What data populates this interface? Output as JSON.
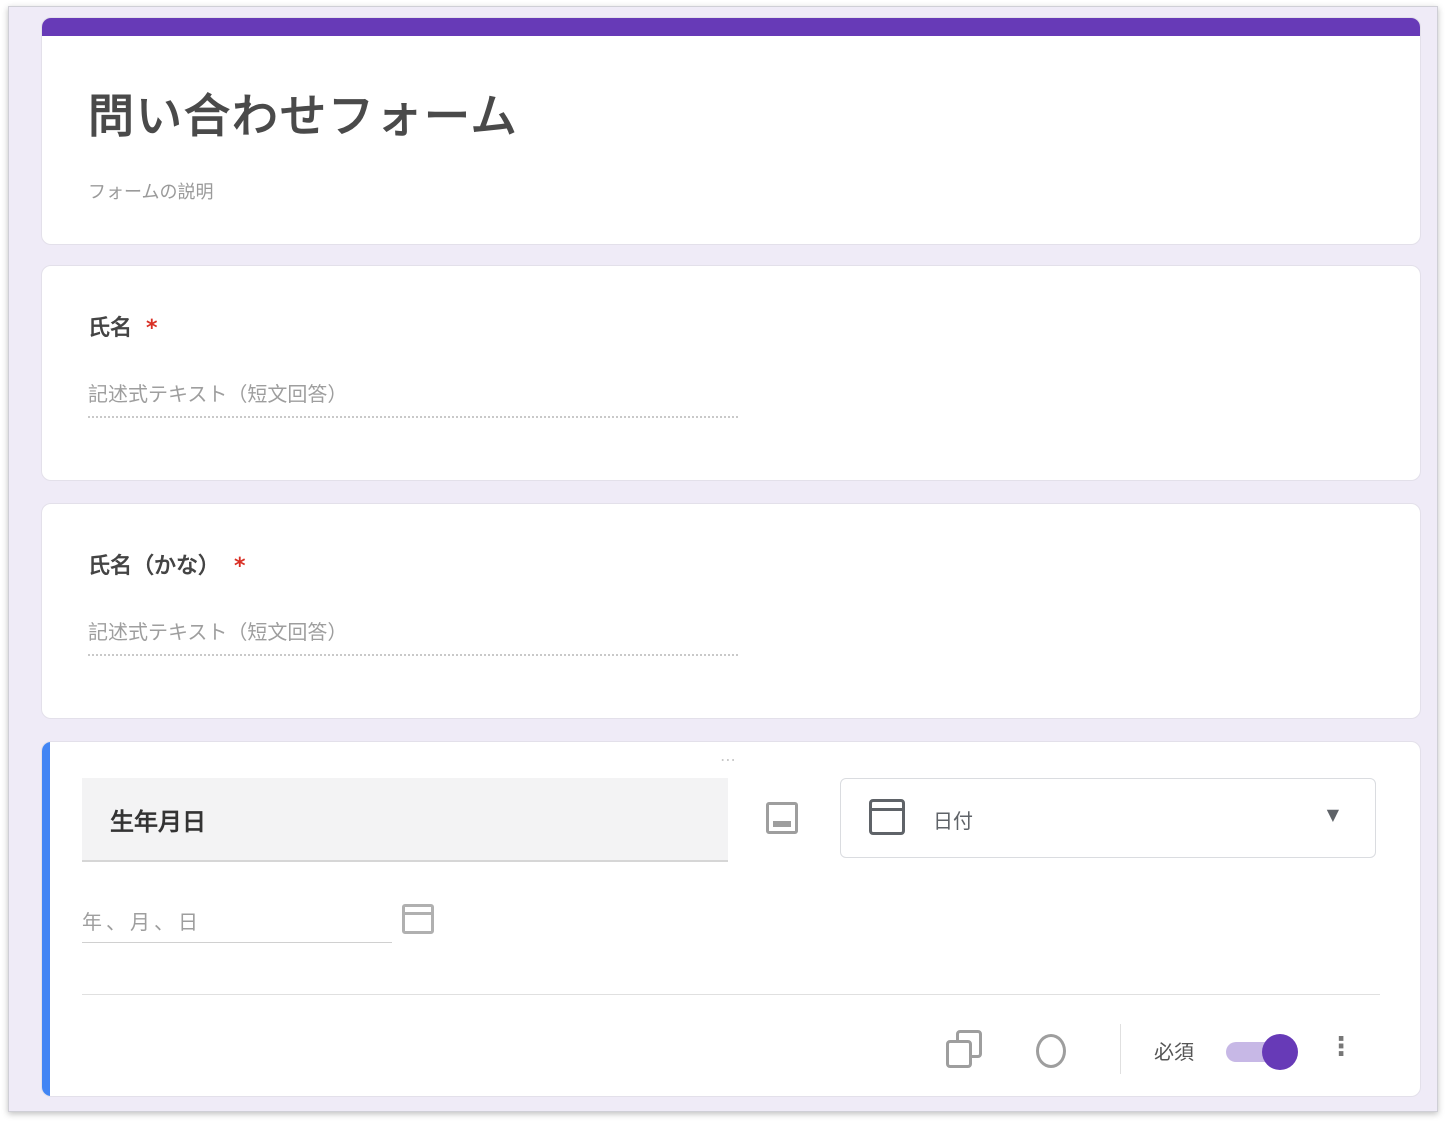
{
  "form": {
    "title": "問い合わせフォーム",
    "description": "フォームの説明"
  },
  "questions": [
    {
      "title": "氏名",
      "required_mark": "*",
      "answer_placeholder": "記述式テキスト（短文回答）"
    },
    {
      "title": "氏名（かな）",
      "required_mark": "*",
      "answer_placeholder": "記述式テキスト（短文回答）"
    }
  ],
  "active_question": {
    "title": "生年月日",
    "type_label": "日付",
    "date_placeholder": "年、月、日",
    "required_label": "必須",
    "required_on": true
  },
  "colors": {
    "accent": "#673ab7",
    "active_bar": "#4285f4",
    "required": "#d93025"
  }
}
